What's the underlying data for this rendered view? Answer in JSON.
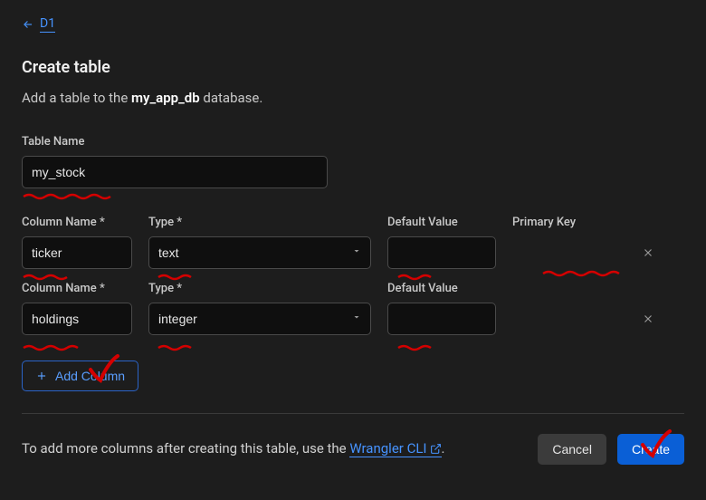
{
  "breadcrumb": {
    "back_label": "D1"
  },
  "header": {
    "title": "Create table",
    "subtitle_prefix": "Add a table to the ",
    "db_name": "my_app_db",
    "subtitle_suffix": " database."
  },
  "form": {
    "table_name_label": "Table Name",
    "table_name_value": "my_stock",
    "labels": {
      "column_name": "Column Name *",
      "type": "Type *",
      "default_value": "Default Value",
      "primary_key": "Primary Key"
    },
    "columns": [
      {
        "name": "ticker",
        "type": "text",
        "default": ""
      },
      {
        "name": "holdings",
        "type": "integer",
        "default": ""
      }
    ],
    "add_column_label": "Add Column"
  },
  "footer": {
    "hint_prefix": "To add more columns after creating this table, use the ",
    "wrangler_label": "Wrangler CLI",
    "hint_suffix": ".",
    "cancel_label": "Cancel",
    "create_label": "Create"
  }
}
